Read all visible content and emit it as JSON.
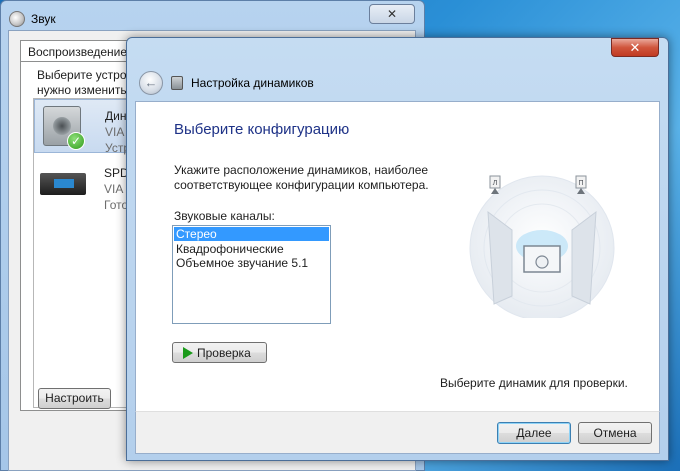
{
  "background_window": {
    "title": "Звук",
    "close_glyph": "✕",
    "tab_label": "Воспроизведение",
    "description_lines": [
      "Выберите устрой",
      "нужно изменить"
    ],
    "devices": [
      {
        "name": "Дина",
        "line2": "VIA",
        "line3": "Устр",
        "icon": "speaker-icon",
        "status_icon": "check-icon"
      },
      {
        "name": "SPDI",
        "line2": "VIA",
        "line3": "Гото",
        "icon": "spdif-device-icon"
      }
    ],
    "configure_button": "Настроить"
  },
  "wizard": {
    "close_glyph": "✕",
    "back_glyph": "←",
    "title": "Настройка динамиков",
    "heading": "Выберите конфигурацию",
    "description": "Укажите расположение динамиков, наиболее соответствующее конфигурации компьютера.",
    "channels_label": "Звуковые каналы:",
    "channels": [
      "Стерео",
      "Квадрофонические",
      "Объемное звучание 5.1"
    ],
    "selected_channel": "Стерео",
    "test_button": "Проверка",
    "speaker_labels": {
      "left": "Л",
      "right": "П"
    },
    "hint": "Выберите динамик для проверки.",
    "next_button": "Далее",
    "cancel_button": "Отмена"
  },
  "colors": {
    "heading_blue": "#1e3287",
    "selection_blue": "#3399ff",
    "close_red": "#c03a22",
    "test_play_green": "#1a9a1a"
  }
}
